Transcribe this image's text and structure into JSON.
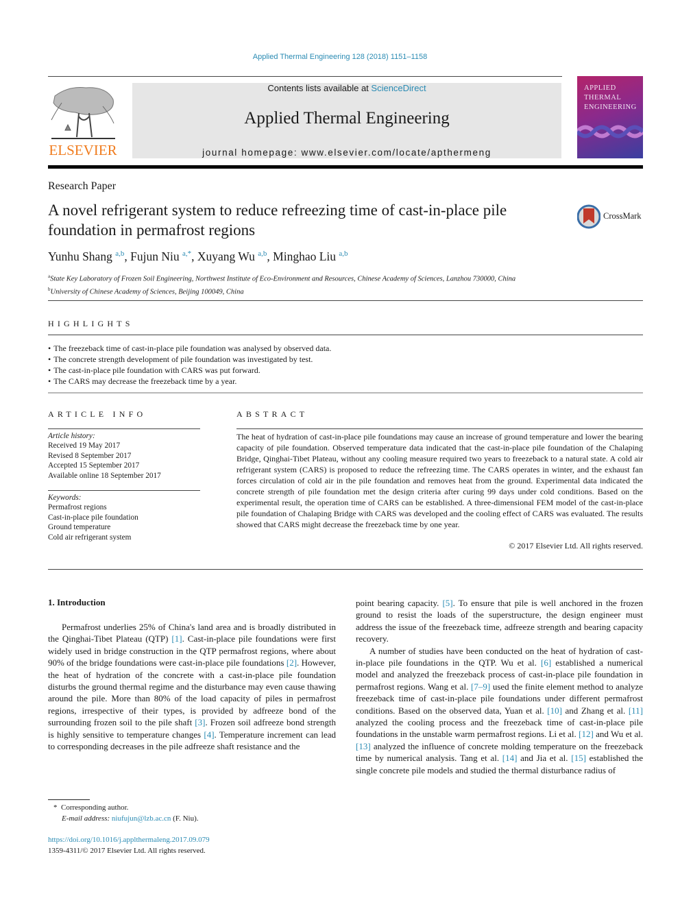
{
  "header": {
    "citation": "Applied Thermal Engineering 128 (2018) 1151–1158",
    "publisher_logo_text": "ELSEVIER",
    "contents_prefix": "Contents lists available at ",
    "contents_link": "ScienceDirect",
    "journal_name": "Applied Thermal Engineering",
    "homepage": "journal homepage: www.elsevier.com/locate/apthermeng",
    "cover_title": [
      "APPLIED",
      "THERMAL",
      "ENGINEERING"
    ]
  },
  "article": {
    "type": "Research Paper",
    "title": "A novel refrigerant system to reduce refreezing time of cast-in-place pile foundation in permafrost regions",
    "crossmark_label": "CrossMark",
    "authors": [
      {
        "name": "Yunhu Shang",
        "sup": "a,b"
      },
      {
        "name": "Fujun Niu",
        "sup": "a,*"
      },
      {
        "name": "Xuyang Wu",
        "sup": "a,b"
      },
      {
        "name": "Minghao Liu",
        "sup": "a,b"
      }
    ],
    "affiliations": [
      {
        "mark": "a",
        "text": "State Key Laboratory of Frozen Soil Engineering, Northwest Institute of Eco-Environment and Resources, Chinese Academy of Sciences, Lanzhou 730000, China"
      },
      {
        "mark": "b",
        "text": "University of Chinese Academy of Sciences, Beijing 100049, China"
      }
    ]
  },
  "highlights": {
    "heading": "HIGHLIGHTS",
    "items": [
      "The freezeback time of cast-in-place pile foundation was analysed by observed data.",
      "The concrete strength development of pile foundation was investigated by test.",
      "The cast-in-place pile foundation with CARS was put forward.",
      "The CARS may decrease the freezeback time by a year."
    ]
  },
  "article_info": {
    "heading": "ARTICLE INFO",
    "history_label": "Article history:",
    "history": [
      "Received 19 May 2017",
      "Revised 8 September 2017",
      "Accepted 15 September 2017",
      "Available online 18 September 2017"
    ],
    "keywords_label": "Keywords:",
    "keywords": [
      "Permafrost regions",
      "Cast-in-place pile foundation",
      "Ground temperature",
      "Cold air refrigerant system"
    ]
  },
  "abstract": {
    "heading": "ABSTRACT",
    "text": "The heat of hydration of cast-in-place pile foundations may cause an increase of ground temperature and lower the bearing capacity of pile foundation. Observed temperature data indicated that the cast-in-place pile foundation of the Chalaping Bridge, Qinghai-Tibet Plateau, without any cooling measure required two years to freezeback to a natural state. A cold air refrigerant system (CARS) is proposed to reduce the refreezing time. The CARS operates in winter, and the exhaust fan forces circulation of cold air in the pile foundation and removes heat from the ground. Experimental data indicated the concrete strength of pile foundation met the design criteria after curing 99 days under cold conditions. Based on the experimental result, the operation time of CARS can be established. A three-dimensional FEM model of the cast-in-place pile foundation of Chalaping Bridge with CARS was developed and the cooling effect of CARS was evaluated. The results showed that CARS might decrease the freezeback time by one year.",
    "copyright": "© 2017 Elsevier Ltd. All rights reserved."
  },
  "body": {
    "section_heading": "1. Introduction",
    "left_column": [
      {
        "t": "Permafrost underlies 25% of China's land area and is broadly distributed in the Qinghai-Tibet Plateau (QTP) "
      },
      {
        "ref": "[1]"
      },
      {
        "t": ". Cast-in-place pile foundations were first widely used in bridge construction in the QTP permafrost regions, where about 90% of the bridge foundations were cast-in-place pile foundations "
      },
      {
        "ref": "[2]"
      },
      {
        "t": ". However, the heat of hydration of the concrete with a cast-in-place pile foundation disturbs the ground thermal regime and the disturbance may even cause thawing around the pile. More than 80% of the load capacity of piles in permafrost regions, irrespective of their types, is provided by adfreeze bond of the surrounding frozen soil to the pile shaft "
      },
      {
        "ref": "[3]"
      },
      {
        "t": ". Frozen soil adfreeze bond strength is highly sensitive to temperature changes "
      },
      {
        "ref": "[4]"
      },
      {
        "t": ". Temperature increment can lead to corresponding decreases in the pile adfreeze shaft resistance and the"
      }
    ],
    "right_column_p1": [
      {
        "t": "point bearing capacity. "
      },
      {
        "ref": "[5]"
      },
      {
        "t": ". To ensure that pile is well anchored in the frozen ground to resist the loads of the superstructure, the design engineer must address the issue of the freezeback time, adfreeze strength and bearing capacity recovery."
      }
    ],
    "right_column_p2": [
      {
        "t": "A number of studies have been conducted on the heat of hydration of cast-in-place pile foundations in the QTP. Wu et al. "
      },
      {
        "ref": "[6]"
      },
      {
        "t": " established a numerical model and analyzed the freezeback process of cast-in-place pile foundation in permafrost regions. Wang et al. "
      },
      {
        "ref": "[7–9]"
      },
      {
        "t": " used the finite element method to analyze freezeback time of cast-in-place pile foundations under different permafrost conditions. Based on the observed data, Yuan et al. "
      },
      {
        "ref": "[10]"
      },
      {
        "t": " and Zhang et al. "
      },
      {
        "ref": "[11]"
      },
      {
        "t": " analyzed the cooling process and the freezeback time of cast-in-place pile foundations in the unstable warm permafrost regions. Li et al. "
      },
      {
        "ref": "[12]"
      },
      {
        "t": " and Wu et al. "
      },
      {
        "ref": "[13]"
      },
      {
        "t": " analyzed the influence of concrete molding temperature on the freezeback time by numerical analysis. Tang et al. "
      },
      {
        "ref": "[14]"
      },
      {
        "t": " and Jia et al. "
      },
      {
        "ref": "[15]"
      },
      {
        "t": " established the single concrete pile models and studied the thermal disturbance radius of"
      }
    ]
  },
  "footer": {
    "corresponding_mark": "*",
    "corresponding_label": "Corresponding author.",
    "email_label": "E-mail address:",
    "email": "niufujun@lzb.ac.cn",
    "email_suffix": "(F. Niu).",
    "doi": "https://doi.org/10.1016/j.applthermaleng.2017.09.079",
    "issn_line": "1359-4311/© 2017 Elsevier Ltd. All rights reserved."
  },
  "colors": {
    "link": "#2a8bb3",
    "elsevier_orange": "#f07c1e",
    "banner_gray": "#e6e6e6"
  }
}
